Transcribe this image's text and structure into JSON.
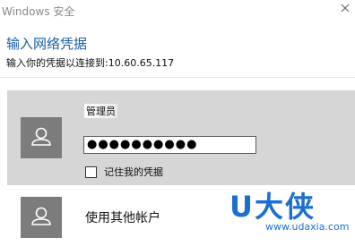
{
  "window": {
    "title": "Windows 安全"
  },
  "dialog": {
    "heading": "输入网络凭据",
    "subtitle": "输入你的凭据以连接到:10.60.65.117"
  },
  "selected_account": {
    "name": "管理员",
    "password_masked": "●●●●●●●●●●",
    "remember_label": "记住我的凭据",
    "remember_checked": false
  },
  "other_account": {
    "label": "使用其他帐户"
  },
  "watermark": {
    "logo": "U大侠",
    "url": "www.udaxia.com"
  },
  "icons": {
    "close": "close-icon",
    "avatar": "user-avatar-icon"
  },
  "colors": {
    "heading": "#1a5fa8",
    "selected_bg": "#d6d6d6",
    "avatar_bg": "#7c7c7c",
    "watermark": "#1a6fd0"
  }
}
